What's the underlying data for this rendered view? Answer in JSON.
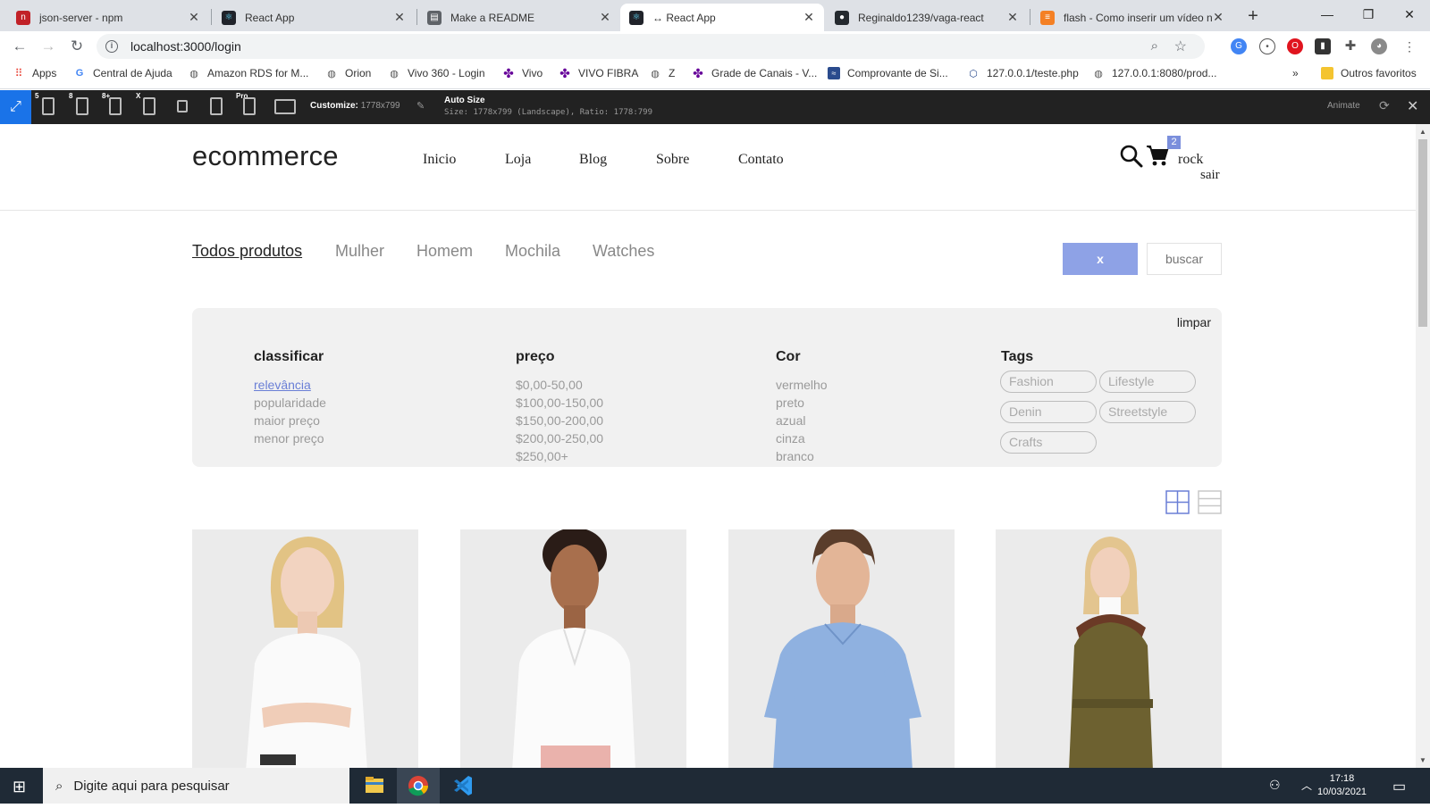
{
  "browser": {
    "tabs": [
      {
        "title": "json-server - npm",
        "icon": "npm-icon",
        "color": "#c12127"
      },
      {
        "title": "React App",
        "icon": "react-icon",
        "color": "#20232a"
      },
      {
        "title": "Make a README",
        "icon": "document-icon",
        "color": "#5f6368"
      },
      {
        "title": "↔ React App",
        "icon": "react-icon",
        "color": "#20232a"
      },
      {
        "title": "Reginaldo1239/vaga-react",
        "icon": "github-icon",
        "color": "#24292e"
      },
      {
        "title": "flash - Como inserir um vídeo n",
        "icon": "stackoverflow-icon",
        "color": "#f48024"
      }
    ],
    "url": "localhost:3000/login",
    "bookmarks": [
      "Apps",
      "Central de Ajuda",
      "Amazon RDS for M...",
      "Orion",
      "Vivo 360 - Login",
      "Vivo",
      "VIVO FIBRA",
      "Z",
      "Grade de Canais - V...",
      "Comprovante de Si...",
      "127.0.0.1/teste.php",
      "127.0.0.1:8080/prod..."
    ],
    "bookmarks_overflow": "»",
    "other_bookmarks": "Outros favoritos"
  },
  "devtools": {
    "device_labels": [
      "5",
      "8",
      "8+",
      "X",
      "",
      "",
      "Pro"
    ],
    "customize_label": "Customize:",
    "customize_value": "1778x799",
    "auto_size_title": "Auto Size",
    "size_info": "Size: 1778x799 (Landscape), Ratio: 1778:799",
    "animate_label": "Animate"
  },
  "site": {
    "logo": "ecommerce",
    "nav": [
      "Inicio",
      "Loja",
      "Blog",
      "Sobre",
      "Contato"
    ],
    "cart_count": "2",
    "user": "rock",
    "logout": "sair",
    "categories": [
      "Todos produtos",
      "Mulher",
      "Homem",
      "Mochila",
      "Watches"
    ],
    "clear_button": "x",
    "search_placeholder": "buscar",
    "filters": {
      "clear_label": "limpar",
      "sort": {
        "heading": "classificar",
        "options": [
          "relevância",
          "popularidade",
          "maior preço",
          "menor preço"
        ],
        "selected": "relevância"
      },
      "price": {
        "heading": "preço",
        "options": [
          "$0,00-50,00",
          "$100,00-150,00",
          "$150,00-200,00",
          "$200,00-250,00",
          "$250,00+"
        ]
      },
      "color": {
        "heading": "Cor",
        "options": [
          "vermelho",
          "preto",
          "azual",
          "cinza",
          "branco"
        ]
      },
      "tags": {
        "heading": "Tags",
        "options": [
          "Fashion",
          "Lifestyle",
          "Denin",
          "Streetstyle",
          "Crafts"
        ]
      }
    },
    "accent_color": "#8ea2e6"
  },
  "taskbar": {
    "search_placeholder": "Digite aqui para pesquisar",
    "time": "17:18",
    "date": "10/03/2021"
  }
}
